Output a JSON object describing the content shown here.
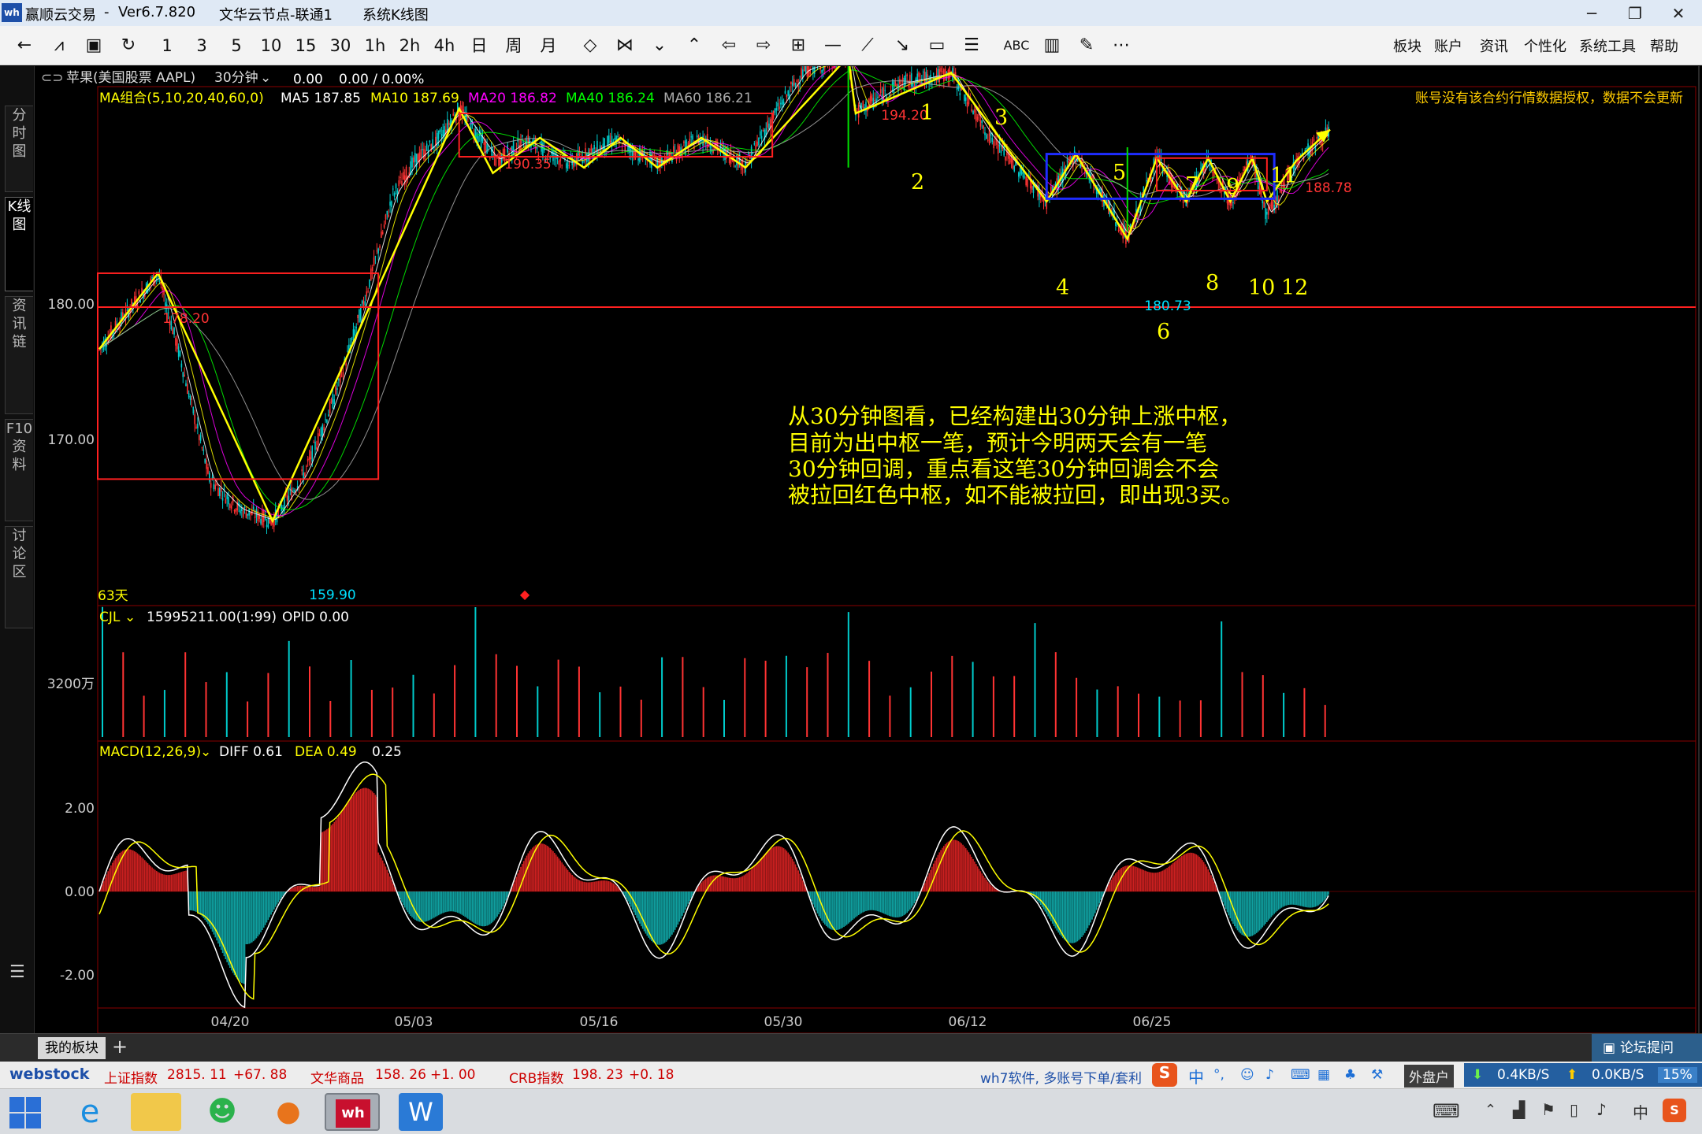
{
  "titlebar": {
    "app": "赢顺云交易",
    "sep": "-",
    "version": "Ver6.7.820",
    "node": "文华云节点-联通1",
    "view": "系统K线图",
    "logo_text": "wh"
  },
  "toolbar": {
    "periods": [
      "1",
      "3",
      "5",
      "10",
      "15",
      "30",
      "1h",
      "2h",
      "4h",
      "日",
      "周",
      "月"
    ],
    "abc_label": "ABC",
    "menus": [
      "板块",
      "账户",
      "资讯",
      "个性化",
      "系统工具",
      "帮助"
    ]
  },
  "leftnav": {
    "tabs": [
      "分时图",
      "K线图",
      "资讯链",
      "F10资料",
      "讨论区"
    ],
    "active": 1
  },
  "symbol": {
    "name": "苹果(美国股票 AAPL)",
    "period": "30分钟",
    "change": "0.00",
    "pct": "0.00 / 0.00%"
  },
  "ma_bar": {
    "label": "MA组合(5,10,20,40,60,0)",
    "ma5": "MA5 187.85",
    "ma10": "MA10 187.69",
    "ma20": "MA20 186.82",
    "ma40": "MA40 186.24",
    "ma60": "MA60 186.21"
  },
  "notice": "账号没有该合约行情数据授权，数据不会更新",
  "colors": {
    "ma5": "#ffffff",
    "ma10": "#ffff00",
    "ma20": "#ff00ff",
    "ma40": "#00ff00",
    "ma60": "#aaaaaa",
    "up": "#ff3333",
    "down": "#00cccc",
    "box_red": "#ff2020",
    "box_blue": "#1e2cff",
    "stroke": "#ffff00"
  },
  "price_axis": {
    "labels": [
      "180.00",
      "170.00"
    ],
    "values": [
      180,
      170
    ]
  },
  "price_labels": {
    "high1": "178.20",
    "low1": "159.90",
    "high2": "190.35",
    "high3": "194.20",
    "low2": "180.73",
    "last": "188.78"
  },
  "wave_numbers": [
    "1",
    "2",
    "3",
    "4",
    "5",
    "6",
    "7",
    "8",
    "9",
    "10",
    "11",
    "12"
  ],
  "days_label": "63天",
  "annotation": [
    "从30分钟图看，已经构建出30分钟上涨中枢，",
    "目前为出中枢一笔，预计今明两天会有一笔",
    "30分钟回调，重点看这笔30分钟回调会不会",
    "被拉回红色中枢，如不能被拉回，即出现3买。"
  ],
  "volume": {
    "label": "CJL",
    "value": "15995211.00(1:99)",
    "opid": "OPID 0.00",
    "axis_label": "3200万"
  },
  "macd": {
    "label": "MACD(12,26,9)",
    "diff": "DIFF 0.61",
    "dea": "DEA 0.49",
    "macd": "0.25",
    "axis_labels": [
      "2.00",
      "0.00",
      "-2.00"
    ],
    "axis_values": [
      2,
      0,
      -2
    ]
  },
  "dates": [
    "04/20",
    "05/03",
    "05/16",
    "05/30",
    "06/12",
    "06/25"
  ],
  "bottom_tabs": {
    "my_block": "我的板块",
    "add": "+",
    "forum": "论坛提问"
  },
  "statusbar": {
    "brand": "webstock",
    "idx1_name": "上证指数",
    "idx1_val": "2815. 11",
    "idx1_chg": "+67. 88",
    "idx2_name": "文华商品",
    "idx2_val": "158. 26",
    "idx2_chg": "+1. 00",
    "idx3_name": "CRB指数",
    "idx3_val": "198. 23",
    "idx3_chg": "+0. 18",
    "promo": "wh7软件, 多账号下单/套利",
    "ime": "中",
    "outer": "外盘户",
    "down_speed": "0.4KB/S",
    "up_speed": "0.0KB/S",
    "cpu": "15%"
  },
  "taskbar": {
    "ime": "中"
  }
}
